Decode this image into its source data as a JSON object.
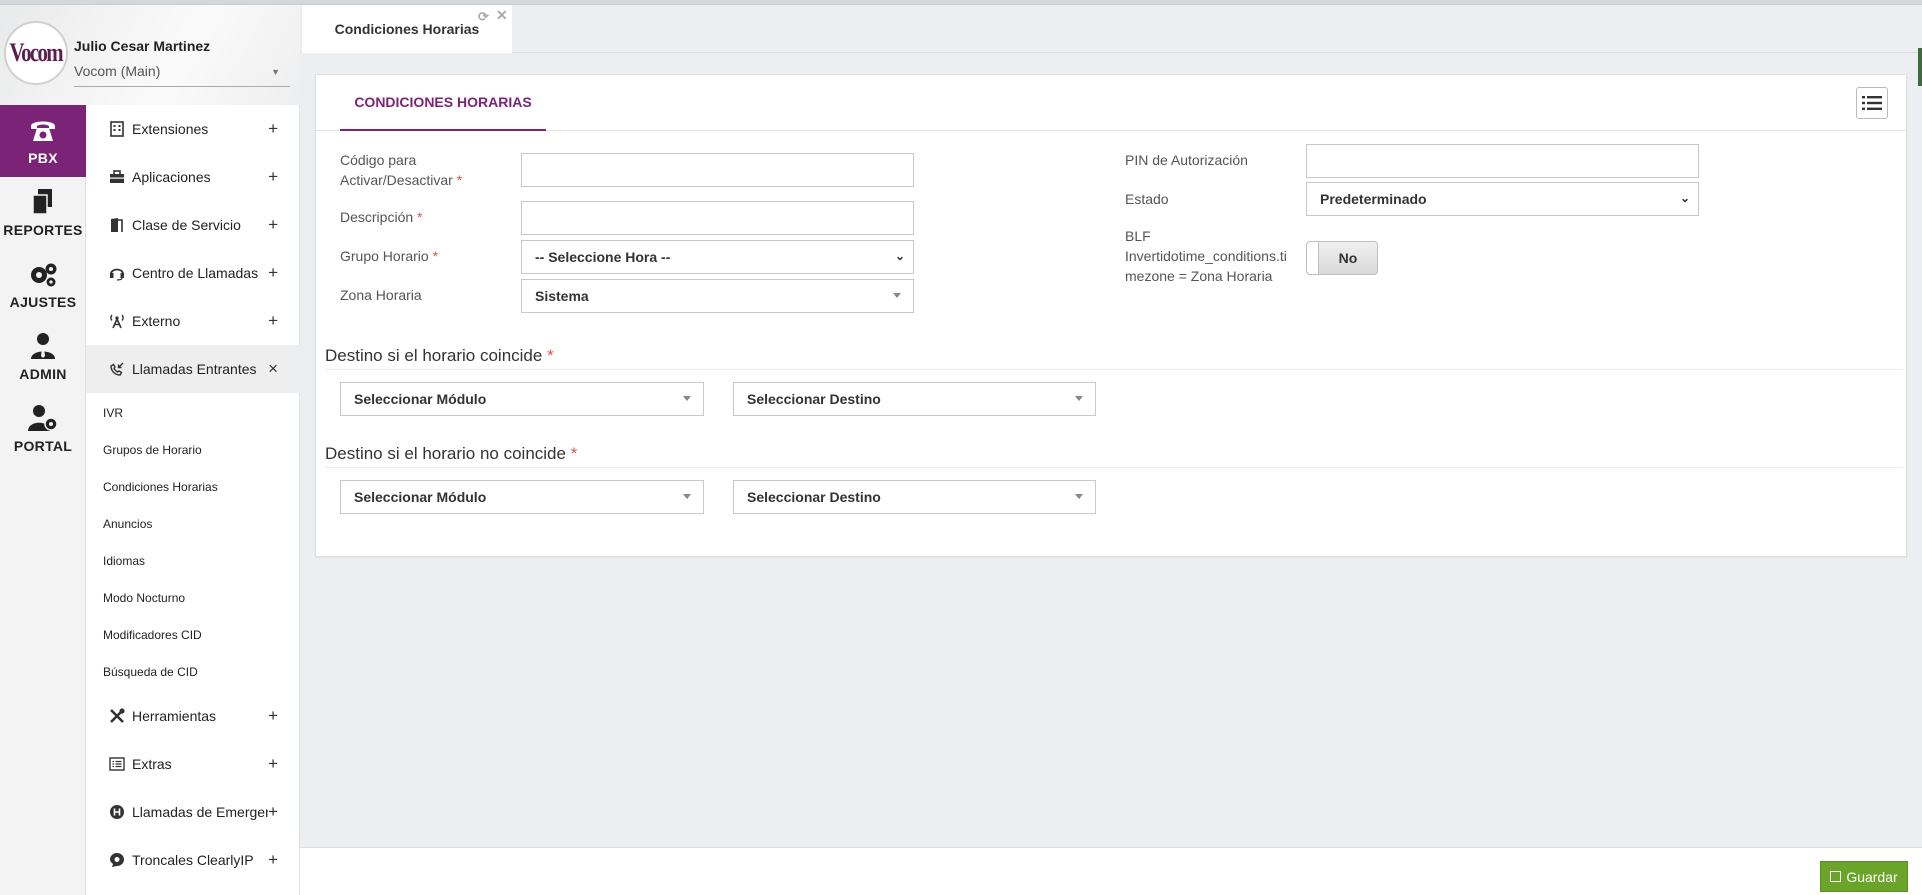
{
  "user": {
    "name": "Julio Cesar Martinez",
    "company": "Vocom (Main)",
    "logo_text": "Vocom"
  },
  "rail": [
    {
      "label": "PBX",
      "icon": "phone-icon",
      "active": true
    },
    {
      "label": "REPORTES",
      "icon": "documents-icon",
      "active": false
    },
    {
      "label": "AJUSTES",
      "icon": "gears-icon",
      "active": false
    },
    {
      "label": "ADMIN",
      "icon": "admin-user-icon",
      "active": false
    },
    {
      "label": "PORTAL",
      "icon": "user-gear-icon",
      "active": false
    }
  ],
  "nav": {
    "items": [
      {
        "label": "Extensiones",
        "icon": "building-icon",
        "toggle": "+"
      },
      {
        "label": "Aplicaciones",
        "icon": "briefcase-icon",
        "toggle": "+"
      },
      {
        "label": "Clase de Servicio",
        "icon": "door-icon",
        "toggle": "+"
      },
      {
        "label": "Centro de Llamadas",
        "icon": "headset-icon",
        "toggle": "+"
      },
      {
        "label": "Externo",
        "icon": "antenna-icon",
        "toggle": "+"
      },
      {
        "label": "Llamadas Entrantes",
        "icon": "incoming-call-icon",
        "toggle": "×"
      }
    ],
    "sub_items": [
      "IVR",
      "Grupos de Horario",
      "Condiciones Horarias",
      "Anuncios",
      "Idiomas",
      "Modo Nocturno",
      "Modificadores CID",
      "Búsqueda de CID"
    ],
    "bottom_items": [
      {
        "label": "Herramientas",
        "icon": "tools-icon",
        "toggle": "+"
      },
      {
        "label": "Extras",
        "icon": "list-icon",
        "toggle": "+"
      },
      {
        "label": "Llamadas de Emergencia",
        "icon": "emergency-icon",
        "toggle": "+"
      },
      {
        "label": "Troncales ClearlyIP",
        "icon": "chat-icon",
        "toggle": "+"
      }
    ]
  },
  "tab": {
    "label": "Condiciones Horarias"
  },
  "panel": {
    "tab_label": "CONDICIONES HORARIAS"
  },
  "form": {
    "code_label_1": "Código para",
    "code_label_2": "Activar/Desactivar",
    "code_value": "",
    "description_label": "Descripción",
    "description_value": "",
    "group_label": "Grupo Horario",
    "group_value": "-- Seleccione Hora --",
    "timezone_label": "Zona Horaria",
    "timezone_value": "Sistema",
    "pin_label": "PIN de Autorización",
    "pin_value": "",
    "state_label": "Estado",
    "state_value": "Predeterminado",
    "blf_label_1": "BLF",
    "blf_label_2": "Invertidotime_conditions.ti",
    "blf_label_3": "mezone = Zona Horaria",
    "blf_value": "No",
    "required_mark": "*"
  },
  "dest_match": {
    "title": "Destino si el horario coincide",
    "module": "Seleccionar Módulo",
    "destination": "Seleccionar Destino"
  },
  "dest_nomatch": {
    "title": "Destino si el horario no coincide",
    "module": "Seleccionar Módulo",
    "destination": "Seleccionar Destino"
  },
  "footer": {
    "save_label": "Guardar"
  },
  "colors": {
    "accent": "#7b2477",
    "save": "#6aa428",
    "required": "#d9534f"
  }
}
